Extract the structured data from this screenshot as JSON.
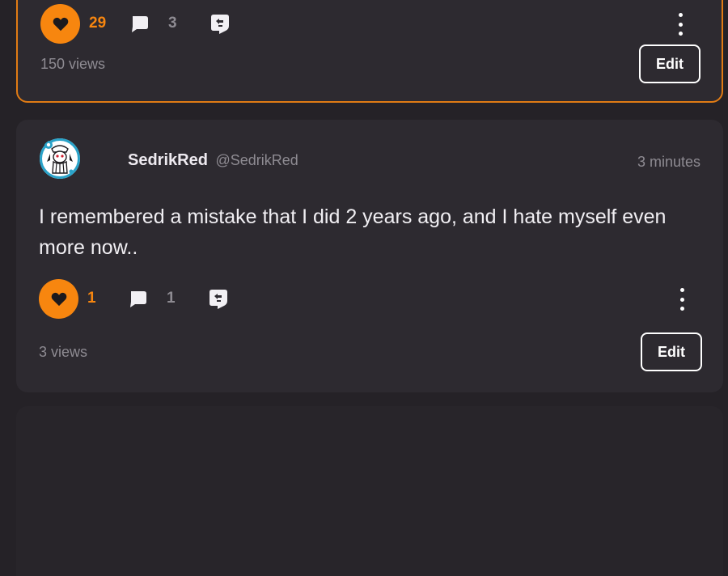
{
  "colors": {
    "accent": "#f7860f",
    "highlight_border": "#e07b14",
    "card_bg": "#2d2a30",
    "page_bg": "#252227",
    "muted_text": "#8e8b92"
  },
  "posts": [
    {
      "highlighted": true,
      "likes": "29",
      "comments": "3",
      "views": "150 views",
      "edit_label": "Edit",
      "icons": [
        "heart-icon",
        "comment-icon",
        "share-icon",
        "more-vertical-icon"
      ]
    },
    {
      "highlighted": false,
      "author_name": "SedrikRed",
      "author_handle": "@SedrikRed",
      "time": "3 minutes",
      "body": "I remembered a mistake that I did 2 years ago, and I hate myself even more now..",
      "likes": "1",
      "comments": "1",
      "views": "3 views",
      "edit_label": "Edit",
      "icons": [
        "heart-icon",
        "comment-icon",
        "share-icon",
        "more-vertical-icon"
      ]
    }
  ]
}
